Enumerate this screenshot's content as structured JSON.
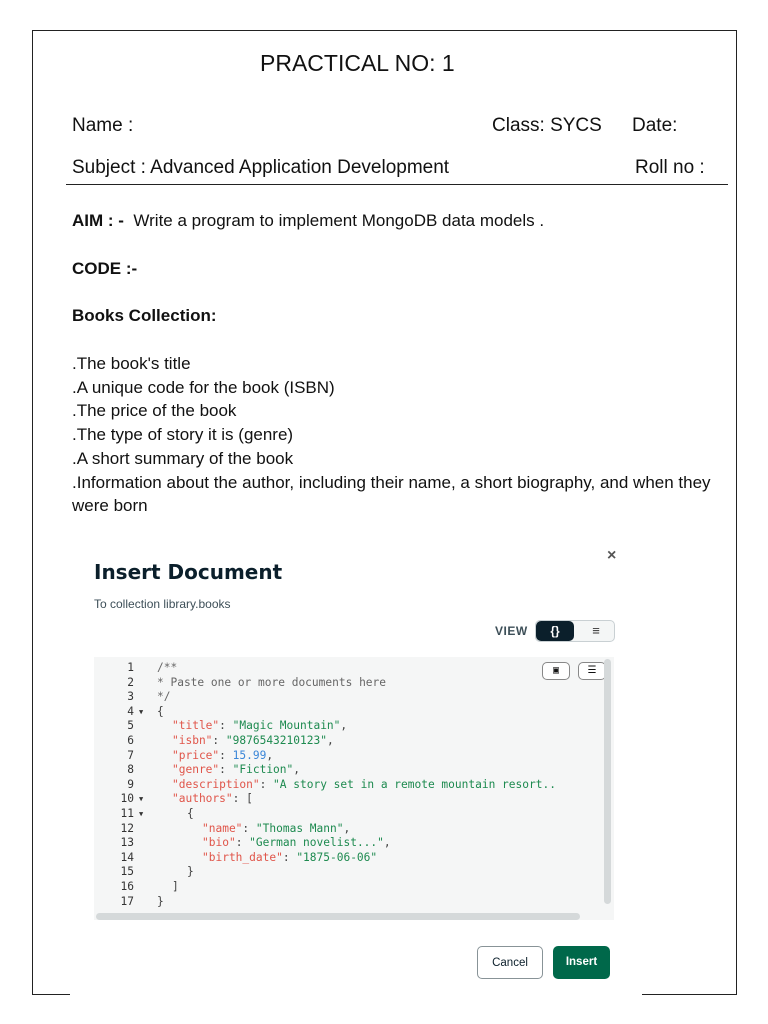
{
  "header": {
    "title": "PRACTICAL NO: 1",
    "name_label": "Name :",
    "class_label": "Class: SYCS",
    "date_label": "Date:",
    "subject_label": "Subject : Advanced Application Development",
    "roll_label": "Roll no :"
  },
  "aim": {
    "label": "AIM : -",
    "text": "Write a program to implement MongoDB data models ."
  },
  "code_heading": "CODE :-",
  "collection_heading": "Books Collection:",
  "bullets": [
    ".The book's title",
    ".A unique code for the book (ISBN)",
    ".The price of the book",
    ".The type of story it is (genre)",
    ".A short summary of the book",
    ".Information about the author, including their name, a short biography, and when they were born"
  ],
  "modal": {
    "title": "Insert Document",
    "subtitle": "To collection library.books",
    "close_icon": "×",
    "view_label": "VIEW",
    "view_json": "{}",
    "view_list": "≡",
    "cancel": "Cancel",
    "insert": "Insert",
    "code_lines": [
      {
        "n": "1",
        "fold": false,
        "indent": 0,
        "tokens": [
          {
            "c": "c",
            "t": "/**"
          }
        ]
      },
      {
        "n": "2",
        "fold": false,
        "indent": 0,
        "tokens": [
          {
            "c": "c",
            "t": "* Paste one or more documents here"
          }
        ]
      },
      {
        "n": "3",
        "fold": false,
        "indent": 0,
        "tokens": [
          {
            "c": "c",
            "t": "*/"
          }
        ]
      },
      {
        "n": "4",
        "fold": true,
        "indent": 0,
        "tokens": [
          {
            "c": "p",
            "t": "{"
          }
        ]
      },
      {
        "n": "5",
        "fold": false,
        "indent": 2,
        "tokens": [
          {
            "c": "k",
            "t": "\"title\""
          },
          {
            "c": "p",
            "t": ": "
          },
          {
            "c": "s",
            "t": "\"Magic Mountain\""
          },
          {
            "c": "p",
            "t": ","
          }
        ]
      },
      {
        "n": "6",
        "fold": false,
        "indent": 2,
        "tokens": [
          {
            "c": "k",
            "t": "\"isbn\""
          },
          {
            "c": "p",
            "t": ": "
          },
          {
            "c": "s",
            "t": "\"9876543210123\""
          },
          {
            "c": "p",
            "t": ","
          }
        ]
      },
      {
        "n": "7",
        "fold": false,
        "indent": 2,
        "tokens": [
          {
            "c": "k",
            "t": "\"price\""
          },
          {
            "c": "p",
            "t": ": "
          },
          {
            "c": "n",
            "t": "15.99"
          },
          {
            "c": "p",
            "t": ","
          }
        ]
      },
      {
        "n": "8",
        "fold": false,
        "indent": 2,
        "tokens": [
          {
            "c": "k",
            "t": "\"genre\""
          },
          {
            "c": "p",
            "t": ": "
          },
          {
            "c": "s",
            "t": "\"Fiction\""
          },
          {
            "c": "p",
            "t": ","
          }
        ]
      },
      {
        "n": "9",
        "fold": false,
        "indent": 2,
        "tokens": [
          {
            "c": "k",
            "t": "\"description\""
          },
          {
            "c": "p",
            "t": ": "
          },
          {
            "c": "s",
            "t": "\"A story set in a remote mountain resort.."
          }
        ]
      },
      {
        "n": "10",
        "fold": true,
        "indent": 2,
        "tokens": [
          {
            "c": "k",
            "t": "\"authors\""
          },
          {
            "c": "p",
            "t": ": ["
          }
        ]
      },
      {
        "n": "11",
        "fold": true,
        "indent": 4,
        "tokens": [
          {
            "c": "p",
            "t": "{"
          }
        ]
      },
      {
        "n": "12",
        "fold": false,
        "indent": 6,
        "tokens": [
          {
            "c": "k",
            "t": "\"name\""
          },
          {
            "c": "p",
            "t": ": "
          },
          {
            "c": "s",
            "t": "\"Thomas Mann\""
          },
          {
            "c": "p",
            "t": ","
          }
        ]
      },
      {
        "n": "13",
        "fold": false,
        "indent": 6,
        "tokens": [
          {
            "c": "k",
            "t": "\"bio\""
          },
          {
            "c": "p",
            "t": ": "
          },
          {
            "c": "s",
            "t": "\"German novelist...\""
          },
          {
            "c": "p",
            "t": ","
          }
        ]
      },
      {
        "n": "14",
        "fold": false,
        "indent": 6,
        "tokens": [
          {
            "c": "k",
            "t": "\"birth_date\""
          },
          {
            "c": "p",
            "t": ": "
          },
          {
            "c": "s",
            "t": "\"1875-06-06\""
          }
        ]
      },
      {
        "n": "15",
        "fold": false,
        "indent": 4,
        "tokens": [
          {
            "c": "p",
            "t": "}"
          }
        ]
      },
      {
        "n": "16",
        "fold": false,
        "indent": 2,
        "tokens": [
          {
            "c": "p",
            "t": "]"
          }
        ]
      },
      {
        "n": "17",
        "fold": false,
        "indent": 0,
        "tokens": [
          {
            "c": "p",
            "t": "}"
          }
        ]
      }
    ]
  }
}
